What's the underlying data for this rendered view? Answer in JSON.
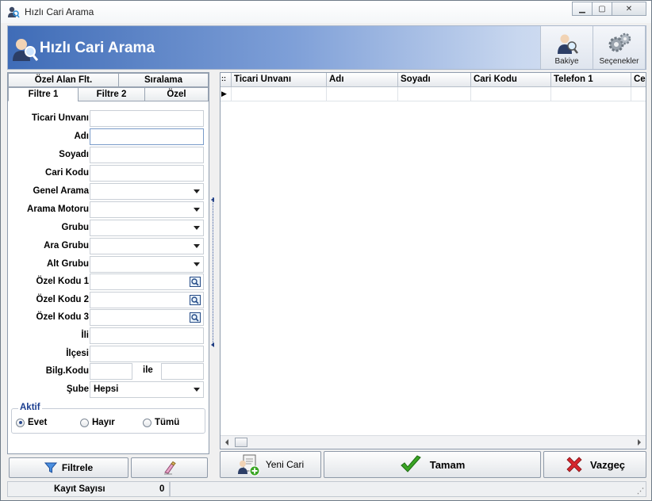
{
  "window": {
    "title": "Hızlı Cari Arama"
  },
  "header": {
    "title": "Hızlı Cari Arama",
    "tools": [
      {
        "label": "Bakiye",
        "icon": "user-search-icon"
      },
      {
        "label": "Seçenekler",
        "icon": "gears-icon"
      }
    ]
  },
  "tabs_top": [
    "Özel Alan Flt.",
    "Sıralama"
  ],
  "tabs_bottom": [
    "Filtre 1",
    "Filtre 2",
    "Özel"
  ],
  "active_tab": "Filtre 1",
  "form": {
    "ticari_unvani": "Ticari Unvanı",
    "adi": "Adı",
    "soyadi": "Soyadı",
    "cari_kodu": "Cari Kodu",
    "genel_arama": "Genel Arama",
    "arama_motoru": "Arama Motoru",
    "grubu": "Grubu",
    "ara_grubu": "Ara Grubu",
    "alt_grubu": "Alt Grubu",
    "ozel_kodu_1": "Özel Kodu 1",
    "ozel_kodu_2": "Özel Kodu 2",
    "ozel_kodu_3": "Özel Kodu 3",
    "ili": "İli",
    "ilcesi": "İlçesi",
    "bilg_kodu": "Bilg.Kodu",
    "ile": "ile",
    "sube": "Şube",
    "sube_value": "Hepsi"
  },
  "aktif": {
    "legend": "Aktif",
    "options": [
      "Evet",
      "Hayır",
      "Tümü"
    ],
    "selected": "Evet"
  },
  "grid": {
    "columns": [
      "Ticari Unvanı",
      "Adı",
      "Soyadı",
      "Cari Kodu",
      "Telefon 1",
      "Ce"
    ],
    "row_indicator": "▶"
  },
  "buttons": {
    "filtrele": "Filtrele",
    "yeni_cari": "Yeni Cari",
    "tamam": "Tamam",
    "vazgec": "Vazgeç"
  },
  "status": {
    "kayit_label": "Kayıt Sayısı",
    "kayit_value": "0"
  },
  "colors": {
    "accent": "#3f6cb7",
    "ok": "#3aa524",
    "cancel": "#d6262d"
  }
}
